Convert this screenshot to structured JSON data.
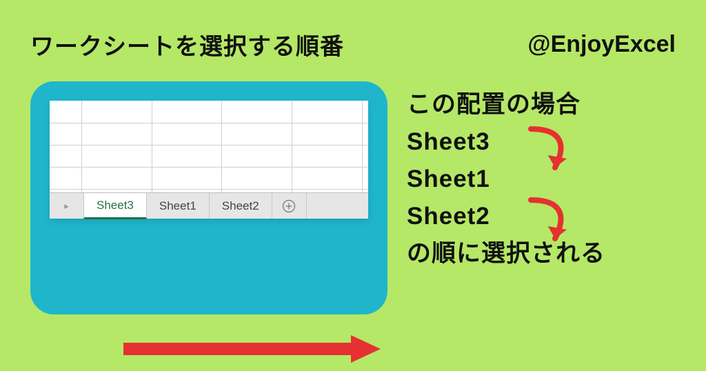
{
  "header": {
    "title": "ワークシートを選択する順番",
    "handle": "@EnjoyExcel"
  },
  "tabs": {
    "items": [
      "Sheet3",
      "Sheet1",
      "Sheet2"
    ],
    "activeIndex": 0,
    "navGlyph": "▸",
    "addGlyph": "+"
  },
  "side": {
    "line1": "この配置の場合",
    "s1": "Sheet3",
    "s2": "Sheet1",
    "s3": "Sheet2",
    "line2": "の順に選択される"
  },
  "colors": {
    "bg": "#b5e866",
    "panel": "#1fb6cc",
    "arrow": "#e53131",
    "excelGreen": "#217346"
  }
}
